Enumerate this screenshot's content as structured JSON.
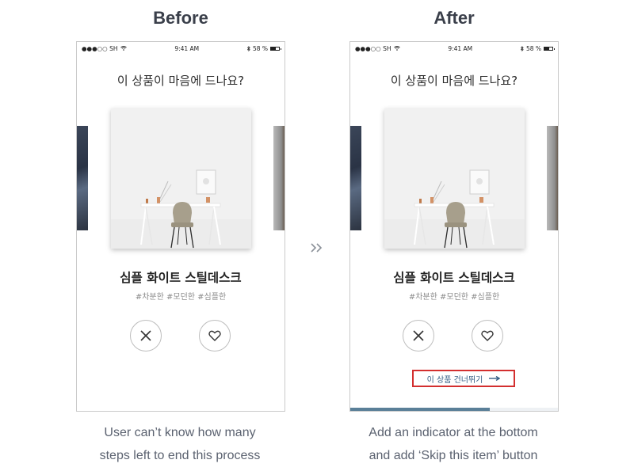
{
  "panels": [
    {
      "title": "Before",
      "caption_line1": "User can’t know how many",
      "caption_line2": "steps left to end this process"
    },
    {
      "title": "After",
      "caption_line1": "Add an indicator at the bottom",
      "caption_line2": "and add ‘Skip this item’ button"
    }
  ],
  "status_bar": {
    "carrier": "●●●○○ SH",
    "time": "9:41 AM",
    "battery": "58 %",
    "battery_level": 0.58
  },
  "screen": {
    "question": "이 상품이 마음에 드나요?",
    "product_name": "심플 화이트 스틸데스크",
    "tags": "#차분한 #모던한 #심플한",
    "skip_label": "이 상품 건너뛰기"
  },
  "progress": 0.67,
  "icons": {
    "dislike": "x-icon",
    "like": "heart-icon",
    "skip_arrow": "arrow-right-icon",
    "transition": "double-chevron-right-icon"
  },
  "colors": {
    "skip_border": "#d32f2f",
    "skip_text": "#355e85",
    "progress_fill": "#5a7f98"
  }
}
